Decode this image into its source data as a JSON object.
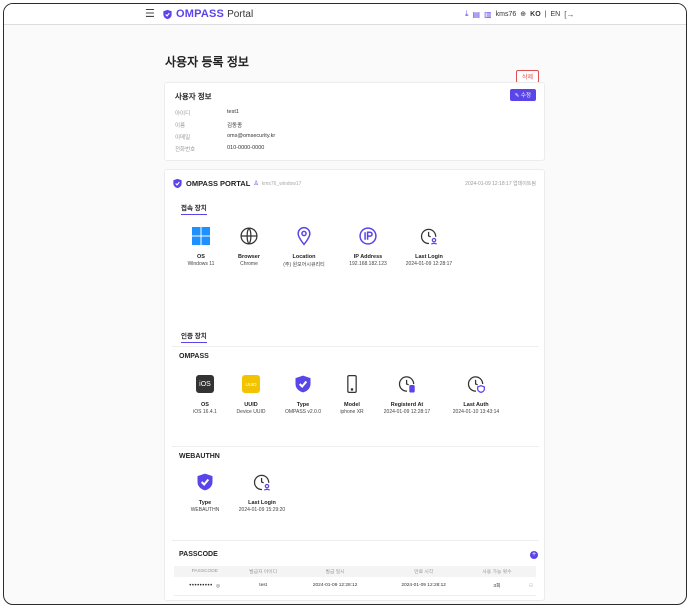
{
  "header": {
    "brand": "OMPASS",
    "portal": "Portal",
    "username": "kms76",
    "lang_ko": "KO",
    "lang_sep": "|",
    "lang_en": "EN"
  },
  "page": {
    "title": "사용자 등록 정보",
    "delete_label": "삭제"
  },
  "user_info": {
    "title": "사용자 정보",
    "edit_label": "수정",
    "rows": [
      {
        "label": "아이디",
        "value": "test1"
      },
      {
        "label": "이름",
        "value": "김동종"
      },
      {
        "label": "이메일",
        "value": "oms@omsecurity.kr"
      },
      {
        "label": "전화번호",
        "value": "010-0000-0000"
      }
    ]
  },
  "portal_card": {
    "title": "OMPASS PORTAL",
    "user_tag": "kms76_window17",
    "date": "2024-01-09 12:18:17 업데이트됨",
    "access_tab": "접속 장치",
    "access": [
      {
        "title": "OS",
        "value": "Windows 11"
      },
      {
        "title": "Browser",
        "value": "Chrome"
      },
      {
        "title": "Location",
        "value": "(주) 원모어시큐리티"
      },
      {
        "title": "IP Address",
        "value": "192.168.182.123"
      },
      {
        "title": "Last Login",
        "value": "2024-01-09 12:28:17"
      }
    ],
    "auth_tab": "인증 장치",
    "ompass": {
      "title": "OMPASS",
      "ios_text": "iOS",
      "uuid_text": "UUID",
      "items": [
        {
          "title": "OS",
          "value": "iOS 16.4.1"
        },
        {
          "title": "UUID",
          "value": "Device UUID"
        },
        {
          "title": "Type",
          "value": "OMPASS v2.0.0"
        },
        {
          "title": "Model",
          "value": "iphone XR"
        },
        {
          "title": "Registerd At",
          "value": "2024-01-09 12:28:17"
        },
        {
          "title": "Last Auth",
          "value": "2024-01-10 13:43:14"
        }
      ]
    },
    "webauthn": {
      "title": "WEBAUTHN",
      "items": [
        {
          "title": "Type",
          "value": "WEBAUTHN"
        },
        {
          "title": "Last Login",
          "value": "2024-01-09 15:29:20"
        }
      ]
    },
    "passcode": {
      "title": "PASSCODE",
      "add_label": "+",
      "columns": [
        "PASSCODE",
        "발급자 아이디",
        "발급 일시",
        "만료 시각",
        "사용 가능 횟수"
      ],
      "rows": [
        {
          "code": "•••••••••",
          "issuer": "test",
          "issued": "2024-01-09 12:28:12",
          "expires": "2024-01-09 12:28:12",
          "count": "3회"
        }
      ]
    }
  },
  "colors": {
    "accent": "#5a45e8",
    "danger": "#e05050",
    "windows": "#1e90ff",
    "uuid": "#f2c400"
  }
}
